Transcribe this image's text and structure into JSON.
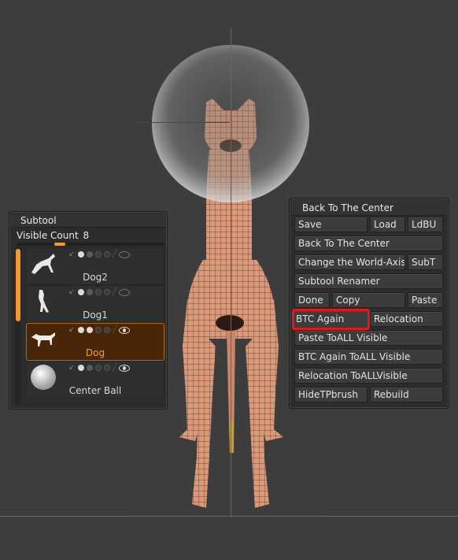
{
  "colors": {
    "background": "#3d3d3d",
    "panel": "#2c2c2c",
    "accent": "#f29a2a",
    "highlight_box": "#e4171c",
    "dog_skin": "#d99a7a"
  },
  "subtool": {
    "title": "Subtool",
    "visible_count_label": "Visible Count",
    "visible_count_value": "8",
    "items": [
      {
        "name": "Dog2",
        "thumb": "dog-jumping-thumbnail",
        "active": false
      },
      {
        "name": "Dog1",
        "thumb": "dog-standing-thumbnail",
        "active": false
      },
      {
        "name": "Dog",
        "thumb": "dog-side-thumbnail",
        "active": true
      },
      {
        "name": "Center Ball",
        "thumb": "sphere-thumbnail",
        "active": false
      }
    ]
  },
  "btc": {
    "title": "Back To The Center",
    "buttons": {
      "save": "Save",
      "load": "Load",
      "ldbu": "LdBU",
      "back_to_center": "Back To The Center",
      "change_world_axis": "Change the World-Axis",
      "subt": "SubT",
      "subtool_renamer": "Subtool Renamer",
      "done": "Done",
      "copy": "Copy",
      "paste": "Paste",
      "btc_again": "BTC Again",
      "relocation": "Relocation",
      "paste_toall_visible": "Paste ToALL Visible",
      "btc_again_toall_visible": "BTC Again ToALL Visible",
      "relocation_toallvisible": "Relocation ToALLVisible",
      "hidetpbrush": "HideTPbrush",
      "rebuild": "Rebuild"
    }
  }
}
